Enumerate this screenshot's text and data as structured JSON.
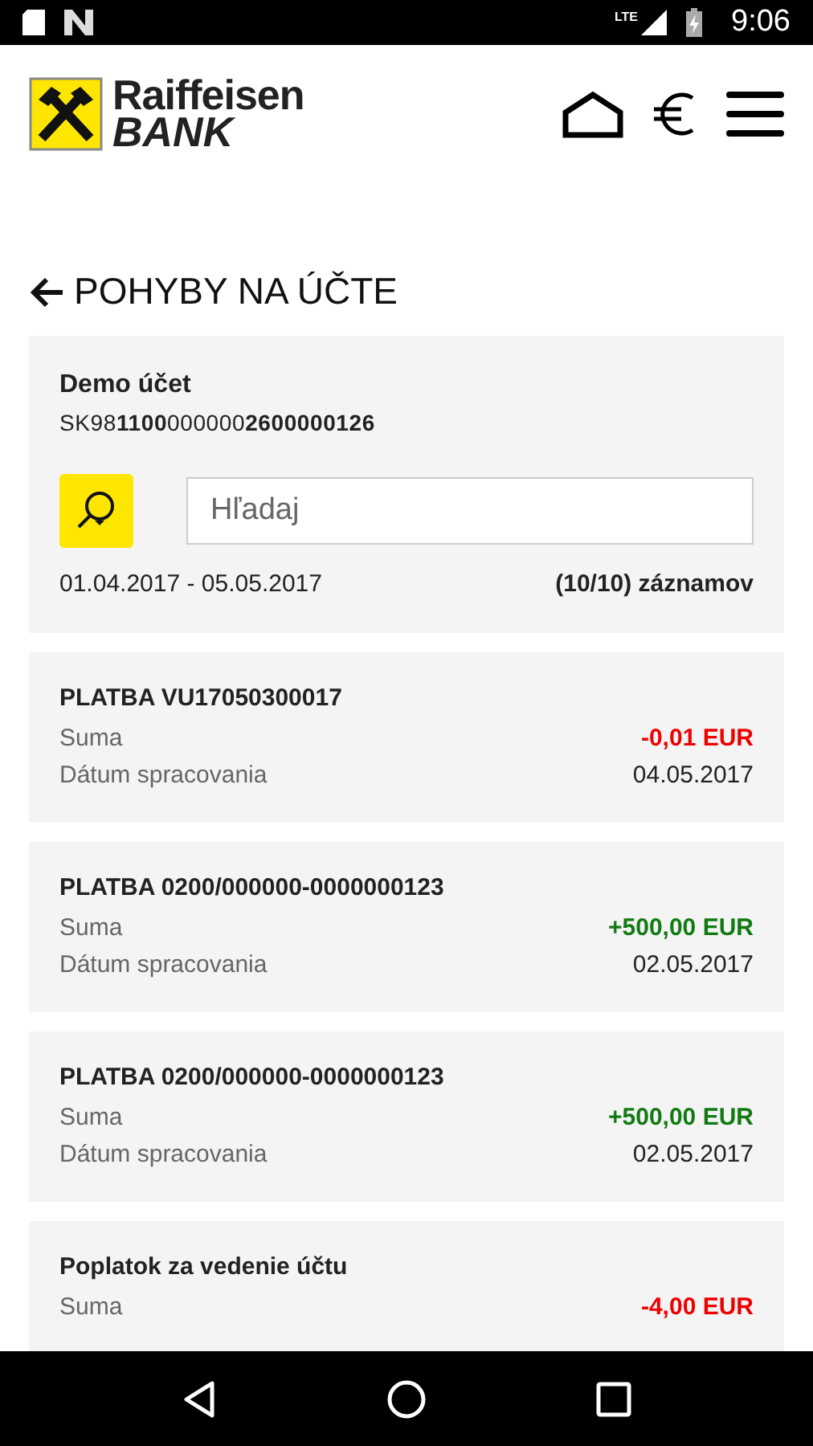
{
  "status_bar": {
    "time": "9:06",
    "network": "LTE"
  },
  "header": {
    "logo_top": "Raiffeisen",
    "logo_bottom": "BANK"
  },
  "page_title": "POHYBY NA ÚČTE",
  "account": {
    "name": "Demo účet",
    "iban": "SK98**1100**000000**2600000126**",
    "search": {
      "placeholder": "Hľadaj"
    },
    "period": "01.04.2017 - 05.05.2017",
    "count": "(10/10) záznamov"
  },
  "transactions": [
    {
      "title": "PLATBA VU17050300017",
      "amount_label": "Suma",
      "amount": "-0,01 EUR",
      "kind": "debit",
      "date_label": "Dátum spracovania",
      "date": "04.05.2017"
    },
    {
      "title": "PLATBA 0200/000000-0000000123",
      "amount_label": "Suma",
      "amount": "+500,00 EUR",
      "kind": "credit",
      "date_label": "Dátum spracovania",
      "date": "02.05.2017"
    },
    {
      "title": "PLATBA 0200/000000-0000000123",
      "amount_label": "Suma",
      "amount": "+500,00 EUR",
      "kind": "credit",
      "date_label": "Dátum spracovania",
      "date": "02.05.2017"
    },
    {
      "title": "Poplatok za vedenie účtu",
      "amount_label": "Suma",
      "amount": "-4,00 EUR",
      "kind": "debit"
    }
  ]
}
